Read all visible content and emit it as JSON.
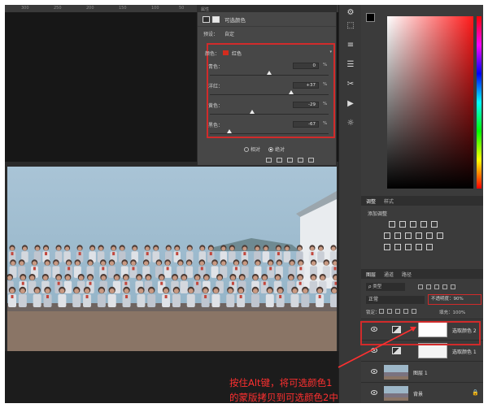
{
  "ruler": {
    "marks": [
      "300",
      "250",
      "200",
      "150",
      "100",
      "50",
      "0",
      "50",
      "100",
      "150"
    ]
  },
  "properties": {
    "tabs": [
      "属性",
      "属性"
    ],
    "title": "可选颜色",
    "preset_label": "预设：",
    "preset_value": "自定",
    "color_label": "颜色：",
    "color_value": "红色",
    "color_swatch": "#d32c1e",
    "sliders": [
      {
        "label": "青色：",
        "value": "0",
        "unit": "%",
        "position": 0.5
      },
      {
        "label": "洋红：",
        "value": "+37",
        "unit": "%",
        "position": 0.685
      },
      {
        "label": "黄色：",
        "value": "-29",
        "unit": "%",
        "position": 0.355
      },
      {
        "label": "黑色：",
        "value": "-67",
        "unit": "%",
        "position": 0.165
      }
    ],
    "radio_relative": "相对",
    "radio_absolute": "绝对",
    "selected_method": "绝对"
  },
  "adjustments": {
    "tabs": [
      "调整",
      "样式"
    ],
    "add_adjustment_label": "添加调整"
  },
  "layers_panel": {
    "tabs": [
      "图层",
      "通道",
      "路径"
    ],
    "filter_label": "ρ 类型",
    "blend_mode": "正常",
    "opacity_label": "不透明度：90%",
    "lock_label": "锁定：",
    "fill_label": "填充：100%",
    "layers": [
      {
        "name": "选取颜色 2",
        "type": "adjustment",
        "highlighted": true
      },
      {
        "name": "选取颜色 1",
        "type": "adjustment",
        "highlighted": false
      },
      {
        "name": "图层 1",
        "type": "image",
        "highlighted": false
      },
      {
        "name": "背景",
        "type": "image",
        "highlighted": false
      }
    ]
  },
  "annotation": {
    "line1": "按住Alt键，将可选颜色1",
    "line2": "的蒙版拷贝到可选颜色2中",
    "color": "#ff3030"
  },
  "colors": {
    "accent_red": "#d12b2b",
    "panel_bg": "#474747",
    "app_bg": "#232323"
  }
}
